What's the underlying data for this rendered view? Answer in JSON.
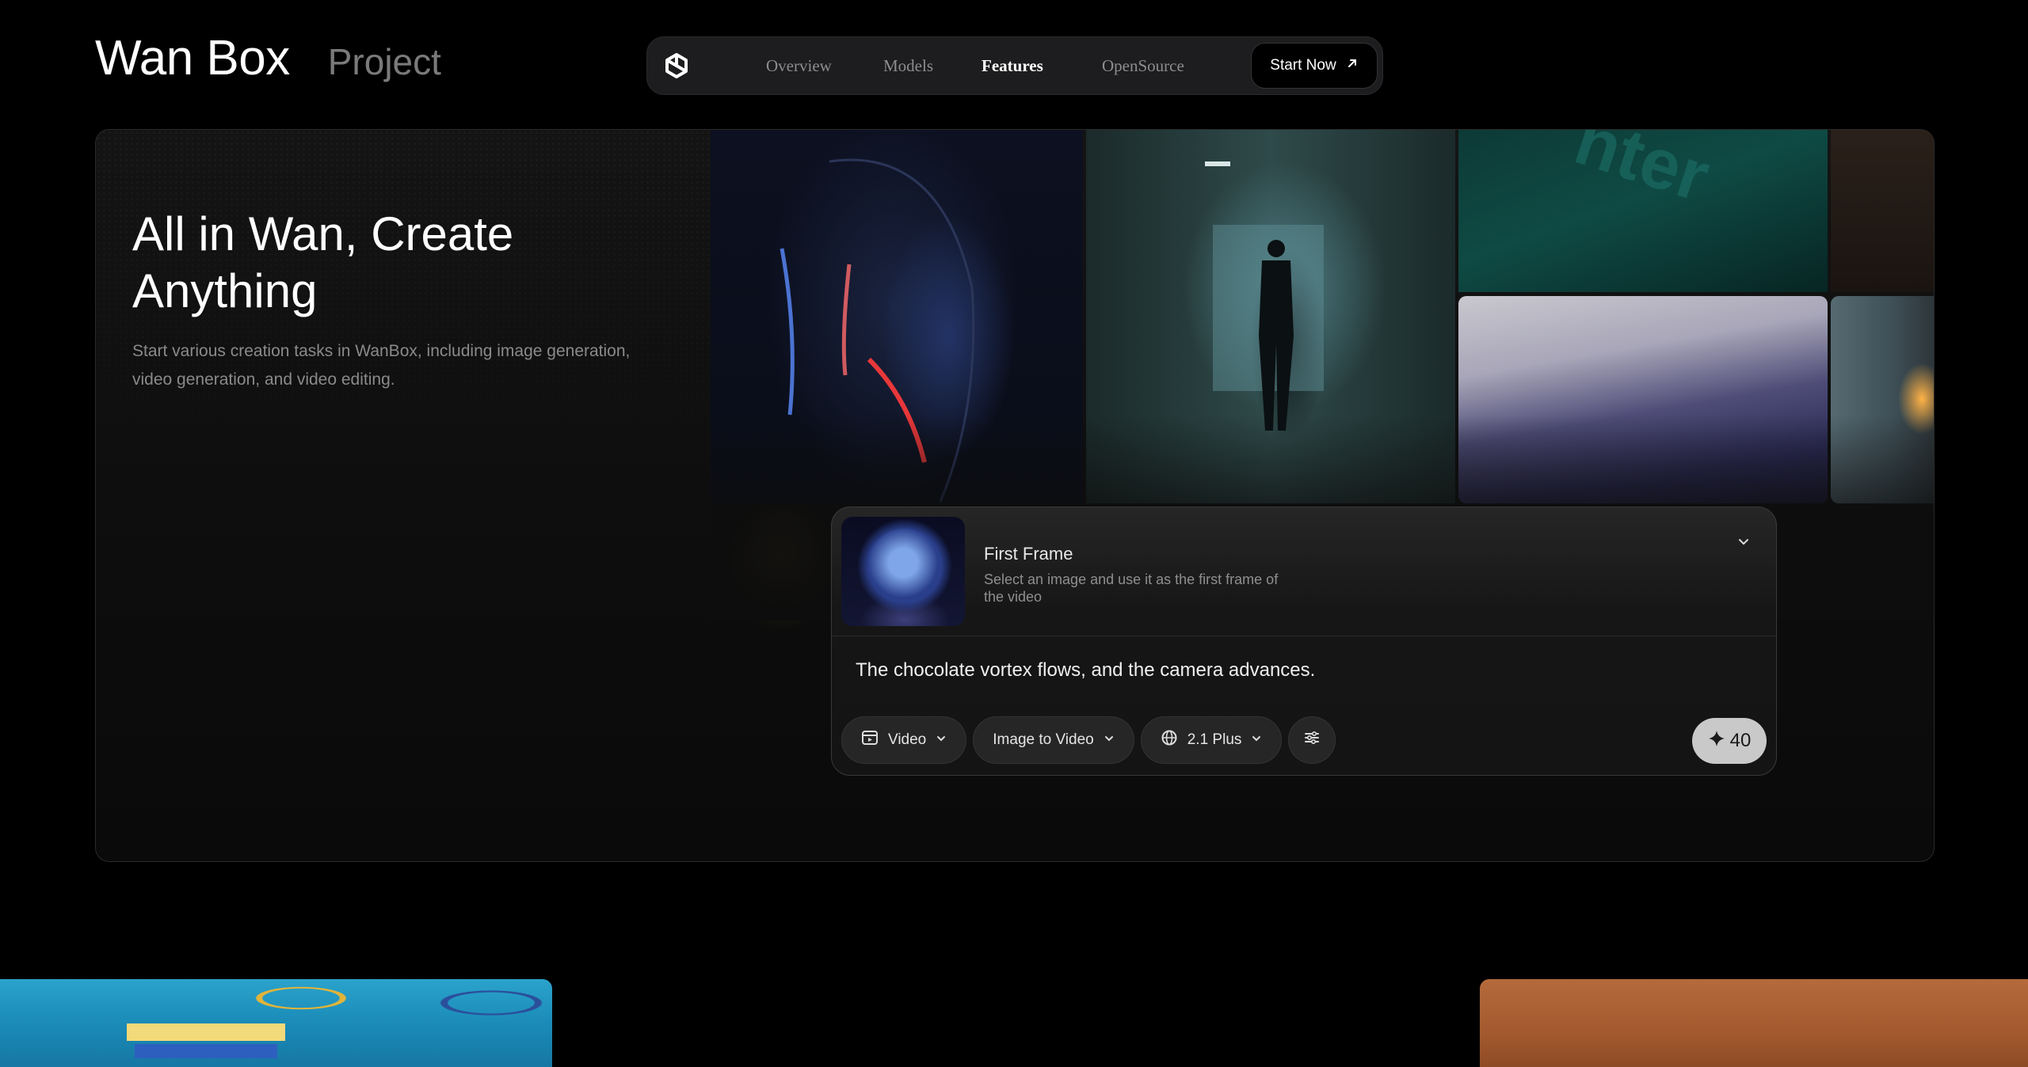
{
  "header": {
    "brand_title": "Wan Box",
    "brand_subtitle": "Project"
  },
  "nav": {
    "logo_icon": "wan-logo-icon",
    "links": [
      {
        "label": "Overview",
        "active": false
      },
      {
        "label": "Models",
        "active": false
      },
      {
        "label": "Features",
        "active": true
      },
      {
        "label": "OpenSource",
        "active": false
      }
    ],
    "cta_label": "Start Now",
    "cta_icon": "arrow-up-right-icon"
  },
  "hero": {
    "title": "All in Wan, Create Anything",
    "description": "Start various creation tasks in WanBox, including image generation, video generation, and video editing."
  },
  "composer": {
    "first_frame": {
      "title": "First Frame",
      "description": "Select an image and use it as the first frame of the video",
      "toggle_icon": "chevron-down-icon"
    },
    "prompt": "The chocolate vortex flows, and the camera advances.",
    "controls": {
      "media_type": {
        "label": "Video",
        "icon": "video-icon"
      },
      "mode": {
        "label": "Image to Video"
      },
      "model": {
        "label": "2.1 Plus",
        "icon": "globe-icon"
      },
      "settings_icon": "sliders-icon"
    },
    "credits": {
      "value": "40",
      "icon": "sparkle-icon"
    }
  },
  "colors": {
    "background": "#000000",
    "card_border": "#2a2a2a",
    "muted_text": "#8a8a8a",
    "credits_bg": "#c9c9c9"
  }
}
